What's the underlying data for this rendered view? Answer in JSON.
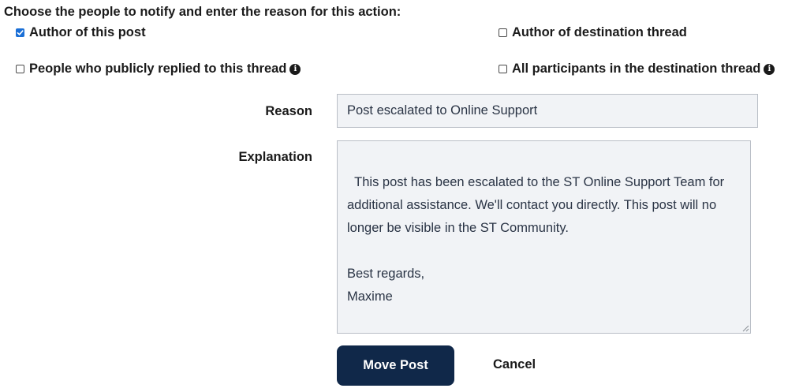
{
  "heading": "Choose the people to notify and enter the reason for this action:",
  "checkboxes": {
    "author_of_post": {
      "label": "Author of this post",
      "checked": true
    },
    "author_of_destination": {
      "label": "Author of destination thread",
      "checked": false
    },
    "public_repliers": {
      "label": "People who publicly replied to this thread",
      "checked": false
    },
    "all_destination_participants": {
      "label": "All participants in the destination thread",
      "checked": false
    }
  },
  "reason": {
    "label": "Reason",
    "value": "Post escalated to Online Support"
  },
  "explanation": {
    "label": "Explanation",
    "value": "This post has been escalated to the ST Online Support Team for\nadditional assistance. We'll contact you directly. This post will no\nlonger be visible in the ST Community.\n\nBest regards,\nMaxime"
  },
  "actions": {
    "move_post": "Move Post",
    "cancel": "Cancel"
  },
  "colors": {
    "primary_button": "#102849",
    "checkbox_checked": "#1a6fd6",
    "input_background": "#f1f3f6"
  },
  "icons": {
    "info": "info-circle-icon",
    "check": "check-icon"
  }
}
